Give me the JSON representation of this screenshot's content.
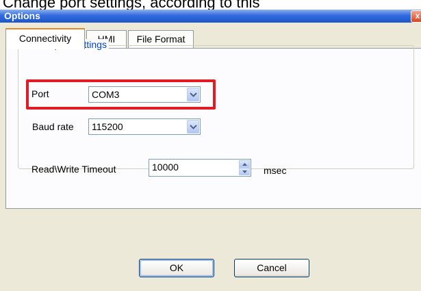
{
  "caption": "Change port settings, according to this",
  "window": {
    "title": "Options",
    "close_glyph": "x"
  },
  "tabs": [
    {
      "label": "Connectivity",
      "active": true
    },
    {
      "label": "HMI",
      "active": false
    },
    {
      "label": "File Format",
      "active": false
    }
  ],
  "serial": {
    "group_label": "Serial port settings",
    "port_label": "Port",
    "port_value": "COM3",
    "baud_label": "Baud rate",
    "baud_value": "115200",
    "timeout_label": "Read\\Write Timeout",
    "timeout_value": "10000",
    "timeout_unit": "msec"
  },
  "buttons": {
    "ok": "OK",
    "cancel": "Cancel"
  },
  "colors": {
    "title_bar": "#2f6be0",
    "dialog_bg": "#ece9d8",
    "highlight": "#e21c24",
    "group_label": "#0046d5"
  },
  "icons": [
    "close-icon",
    "chevron-down-icon",
    "spin-up-icon",
    "spin-down-icon"
  ]
}
